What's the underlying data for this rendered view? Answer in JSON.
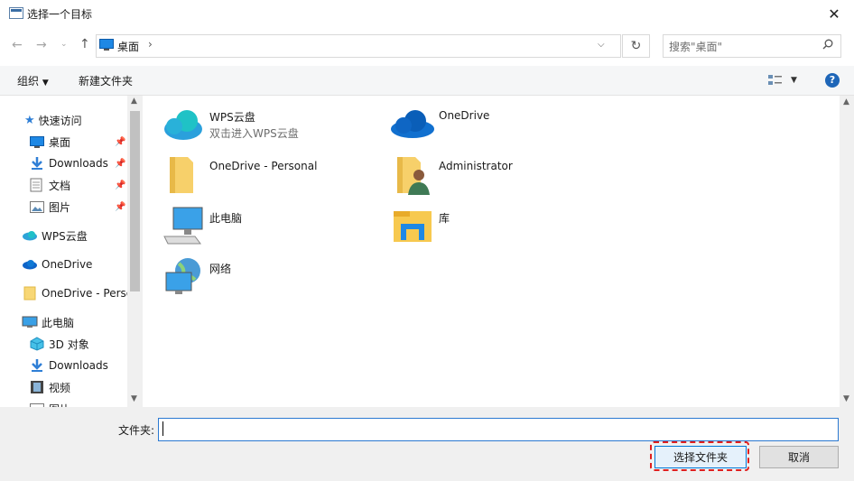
{
  "window": {
    "title": "选择一个目标"
  },
  "address": {
    "location": "桌面",
    "search_placeholder": "搜索\"桌面\""
  },
  "toolbar": {
    "organize": "组织",
    "new_folder": "新建文件夹"
  },
  "sidebar": {
    "quick_access": "快速访问",
    "items": [
      {
        "label": "桌面",
        "pinned": true
      },
      {
        "label": "Downloads",
        "pinned": true
      },
      {
        "label": "文档",
        "pinned": true
      },
      {
        "label": "图片",
        "pinned": true
      }
    ],
    "wps": "WPS云盘",
    "onedrive": "OneDrive",
    "onedrive_personal": "OneDrive - Personal",
    "this_pc": "此电脑",
    "pc_items": [
      "3D 对象",
      "Downloads",
      "视频",
      "图片"
    ]
  },
  "main": {
    "tiles": [
      {
        "name": "WPS云盘",
        "sub": "双击进入WPS云盘"
      },
      {
        "name": "OneDrive"
      },
      {
        "name": "OneDrive - Personal"
      },
      {
        "name": "Administrator"
      },
      {
        "name": "此电脑"
      },
      {
        "name": "库"
      },
      {
        "name": "网络"
      }
    ]
  },
  "bottom": {
    "folder_label": "文件夹:",
    "folder_value": "",
    "select_button": "选择文件夹",
    "cancel_button": "取消"
  },
  "colors": {
    "accent": "#0078d7",
    "highlight": "#e01e1e"
  }
}
